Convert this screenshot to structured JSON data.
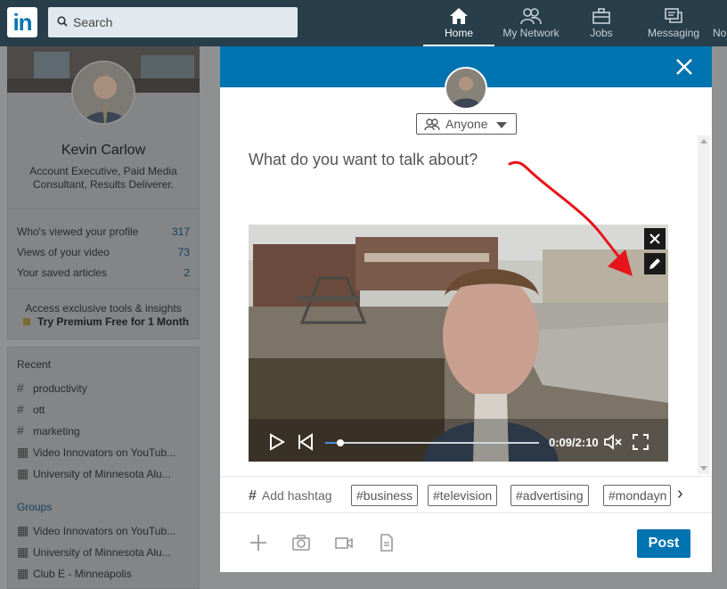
{
  "nav": {
    "logo": "in",
    "search_placeholder": "Search",
    "items": [
      {
        "label": "Home",
        "icon": "home-icon",
        "active": true
      },
      {
        "label": "My Network",
        "icon": "network-icon"
      },
      {
        "label": "Jobs",
        "icon": "jobs-icon"
      },
      {
        "label": "Messaging",
        "icon": "messaging-icon"
      },
      {
        "label": "No",
        "icon": "notifications-icon"
      }
    ]
  },
  "profile": {
    "name": "Kevin Carlow",
    "headline": "Account Executive, Paid Media Consultant, Results Deliverer.",
    "stats": [
      {
        "label": "Who's viewed your profile",
        "value": "317"
      },
      {
        "label": "Views of your video",
        "value": "73"
      },
      {
        "label": "Your saved articles",
        "value": "2"
      }
    ],
    "premium_line1": "Access exclusive tools & insights",
    "premium_line2": "Try Premium Free for 1 Month"
  },
  "sidebar": {
    "recent_heading": "Recent",
    "recent": [
      {
        "label": "productivity",
        "icon": "hashtag-icon"
      },
      {
        "label": "ott",
        "icon": "hashtag-icon"
      },
      {
        "label": "marketing",
        "icon": "hashtag-icon"
      },
      {
        "label": "Video Innovators on YouTub...",
        "icon": "group-icon"
      },
      {
        "label": "University of Minnesota Alu...",
        "icon": "group-icon"
      }
    ],
    "groups_heading": "Groups",
    "groups": [
      {
        "label": "Video Innovators on YouTub...",
        "icon": "group-icon"
      },
      {
        "label": "University of Minnesota Alu...",
        "icon": "group-icon"
      },
      {
        "label": "Club E - Minneapolis",
        "icon": "group-icon"
      }
    ]
  },
  "modal": {
    "audience": "Anyone",
    "composer_placeholder": "What do you want to talk about?",
    "video": {
      "time": "0:09/2:10",
      "progress": 0.07
    },
    "add_hashtag": "Add hashtag",
    "hashtags": [
      "#business",
      "#television",
      "#advertising",
      "#mondayn"
    ],
    "post_label": "Post"
  },
  "colors": {
    "nav_bg": "#283e4a",
    "brand_blue": "#0073b1",
    "annotation_red": "#e8141b"
  }
}
